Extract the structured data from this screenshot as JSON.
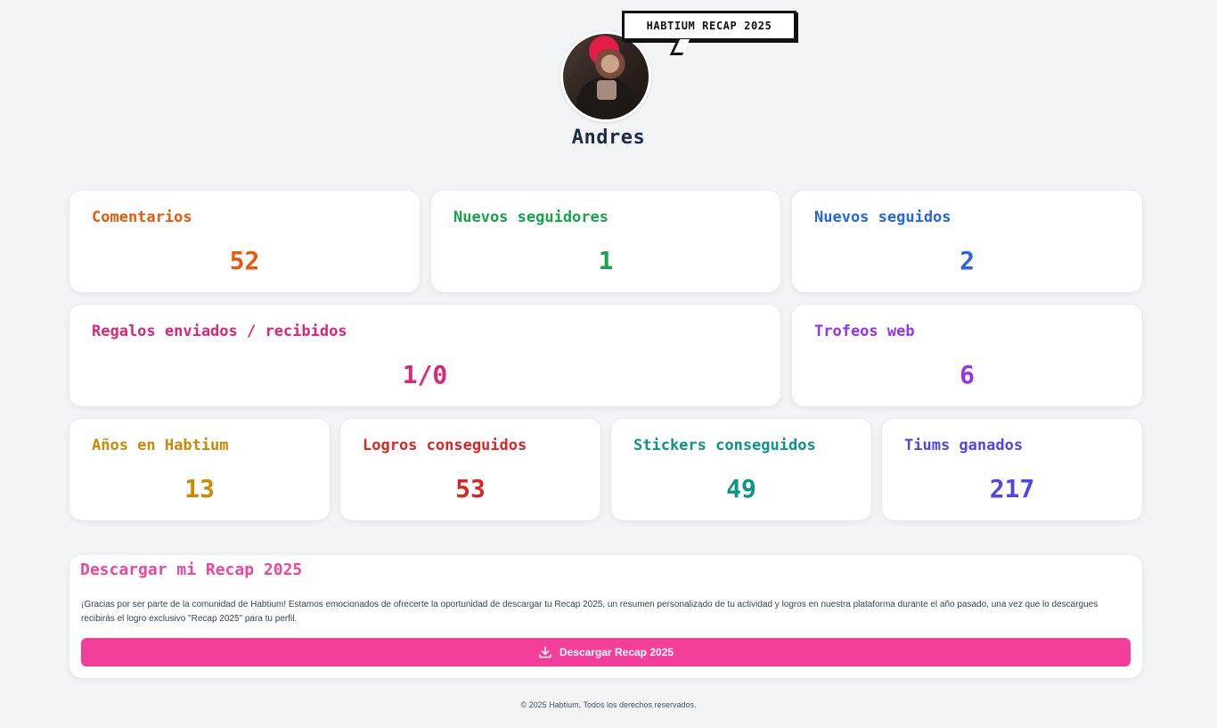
{
  "profile": {
    "bubble_text": "HABTIUM RECAP 2025",
    "username": "Andres"
  },
  "stats": {
    "comentarios": {
      "label": "Comentarios",
      "value": "52",
      "color": "#ea580c"
    },
    "nuevos_seguidores": {
      "label": "Nuevos seguidores",
      "value": "1",
      "color": "#16a34a"
    },
    "nuevos_seguidos": {
      "label": "Nuevos seguidos",
      "value": "2",
      "color": "#2563eb"
    },
    "regalos": {
      "label": "Regalos enviados / recibidos",
      "value": "1/0",
      "color": "#db2777"
    },
    "trofeos": {
      "label": "Trofeos web",
      "value": "6",
      "color": "#9333ea"
    },
    "anos": {
      "label": "Años en Habtium",
      "value": "13",
      "color": "#ca8a04"
    },
    "logros": {
      "label": "Logros conseguidos",
      "value": "53",
      "color": "#dc2626"
    },
    "stickers": {
      "label": "Stickers conseguidos",
      "value": "49",
      "color": "#0d9488"
    },
    "tiums": {
      "label": "Tiums ganados",
      "value": "217",
      "color": "#4f46e5"
    }
  },
  "download": {
    "title": "Descargar mi Recap 2025",
    "text": "¡Gracias por ser parte de la comunidad de Habtium! Estamos emocionados de ofrecerte la oportunidad de descargar tu Recap 2025, un resumen personalizado de tu actividad y logros en nuestra plataforma durante el año pasado, una vez que lo descargues recibirás el logro exclusivo \"Recap 2025\" para tu perfil.",
    "button_label": "Descargar Recap 2025",
    "button_color": "#f43f9a",
    "icon": "download-icon"
  },
  "footer": {
    "text": "© 2025 Habtium. Todos los derechos reservados."
  }
}
